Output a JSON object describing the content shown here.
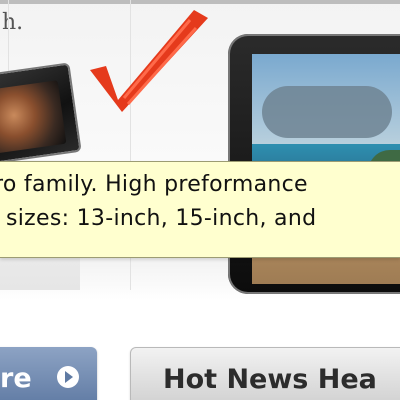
{
  "page": {
    "top_fragment": "h."
  },
  "tooltip": {
    "line1": "ro family. High preformance",
    "line2": "sizes: 13-inch, 15-inch, and"
  },
  "buttons": {
    "left_label": "re",
    "right_label": "Hot News Hea"
  },
  "icons": {
    "checkmark": "red-checkmark-icon",
    "button_arrow": "circle-arrow-right-icon"
  },
  "colors": {
    "tooltip_bg": "#ffffcf",
    "left_button": "#5f7aa3",
    "right_button": "#cfcfcf",
    "checkmark": "#e53a1c"
  }
}
